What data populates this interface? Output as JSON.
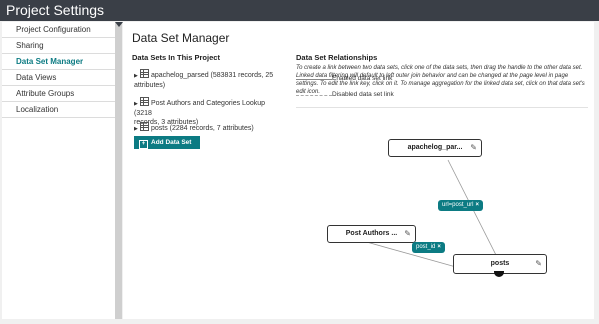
{
  "app": {
    "title": "Project Settings"
  },
  "sidebar": {
    "items": [
      {
        "label": "Project Configuration",
        "active": false
      },
      {
        "label": "Sharing",
        "active": false
      },
      {
        "label": "Data Set Manager",
        "active": true
      },
      {
        "label": "Data Views",
        "active": false
      },
      {
        "label": "Attribute Groups",
        "active": false
      },
      {
        "label": "Localization",
        "active": false
      }
    ]
  },
  "main": {
    "title": "Data Set Manager",
    "datasets": {
      "heading": "Data Sets In This Project",
      "items": [
        {
          "line1": "apachelog_parsed (583831 records, 25",
          "line2": "attributes)"
        },
        {
          "line1": "Post Authors and Categories Lookup (3218",
          "line2": "records, 3 attributes)"
        },
        {
          "line1": "posts (2284 records, 7 attributes)",
          "line2": ""
        }
      ],
      "add_label": "Add Data Set"
    },
    "relationships": {
      "heading": "Data Set Relationships",
      "description": "To create a link between two data sets, click one of the data sets, then drag the handle to the other data set. Linked data filtering will default to left outer join behavior and can be changed at the page level in page settings. To edit the link key, click on it. To manage aggregation for the linked data set, click on that data set's edit icon.",
      "legend": [
        {
          "label": "Enabled data set link",
          "style": "solid"
        },
        {
          "label": "Disabled data set link",
          "style": "dashed"
        }
      ],
      "nodes": [
        {
          "label": "apachelog_par..."
        },
        {
          "label": "Post Authors ..."
        },
        {
          "label": "posts"
        }
      ],
      "links": [
        {
          "label": "url=post_url"
        },
        {
          "label": "post_id"
        }
      ]
    }
  },
  "colors": {
    "accent": "#0c7b83",
    "titlebar": "#3a3f47"
  }
}
